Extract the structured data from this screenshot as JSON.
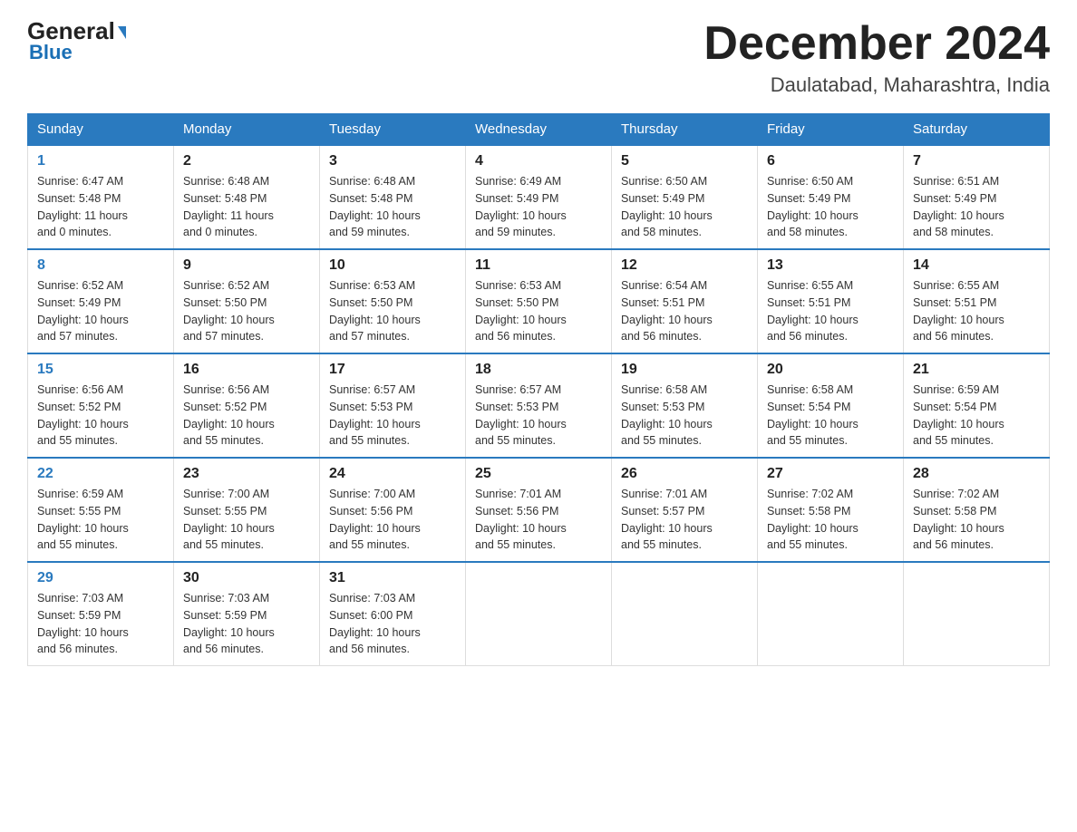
{
  "header": {
    "logo_general": "General",
    "logo_blue": "Blue",
    "month_title": "December 2024",
    "subtitle": "Daulatabad, Maharashtra, India"
  },
  "days_of_week": [
    "Sunday",
    "Monday",
    "Tuesday",
    "Wednesday",
    "Thursday",
    "Friday",
    "Saturday"
  ],
  "weeks": [
    [
      {
        "day": "1",
        "info": "Sunrise: 6:47 AM\nSunset: 5:48 PM\nDaylight: 11 hours\nand 0 minutes."
      },
      {
        "day": "2",
        "info": "Sunrise: 6:48 AM\nSunset: 5:48 PM\nDaylight: 11 hours\nand 0 minutes."
      },
      {
        "day": "3",
        "info": "Sunrise: 6:48 AM\nSunset: 5:48 PM\nDaylight: 10 hours\nand 59 minutes."
      },
      {
        "day": "4",
        "info": "Sunrise: 6:49 AM\nSunset: 5:49 PM\nDaylight: 10 hours\nand 59 minutes."
      },
      {
        "day": "5",
        "info": "Sunrise: 6:50 AM\nSunset: 5:49 PM\nDaylight: 10 hours\nand 58 minutes."
      },
      {
        "day": "6",
        "info": "Sunrise: 6:50 AM\nSunset: 5:49 PM\nDaylight: 10 hours\nand 58 minutes."
      },
      {
        "day": "7",
        "info": "Sunrise: 6:51 AM\nSunset: 5:49 PM\nDaylight: 10 hours\nand 58 minutes."
      }
    ],
    [
      {
        "day": "8",
        "info": "Sunrise: 6:52 AM\nSunset: 5:49 PM\nDaylight: 10 hours\nand 57 minutes."
      },
      {
        "day": "9",
        "info": "Sunrise: 6:52 AM\nSunset: 5:50 PM\nDaylight: 10 hours\nand 57 minutes."
      },
      {
        "day": "10",
        "info": "Sunrise: 6:53 AM\nSunset: 5:50 PM\nDaylight: 10 hours\nand 57 minutes."
      },
      {
        "day": "11",
        "info": "Sunrise: 6:53 AM\nSunset: 5:50 PM\nDaylight: 10 hours\nand 56 minutes."
      },
      {
        "day": "12",
        "info": "Sunrise: 6:54 AM\nSunset: 5:51 PM\nDaylight: 10 hours\nand 56 minutes."
      },
      {
        "day": "13",
        "info": "Sunrise: 6:55 AM\nSunset: 5:51 PM\nDaylight: 10 hours\nand 56 minutes."
      },
      {
        "day": "14",
        "info": "Sunrise: 6:55 AM\nSunset: 5:51 PM\nDaylight: 10 hours\nand 56 minutes."
      }
    ],
    [
      {
        "day": "15",
        "info": "Sunrise: 6:56 AM\nSunset: 5:52 PM\nDaylight: 10 hours\nand 55 minutes."
      },
      {
        "day": "16",
        "info": "Sunrise: 6:56 AM\nSunset: 5:52 PM\nDaylight: 10 hours\nand 55 minutes."
      },
      {
        "day": "17",
        "info": "Sunrise: 6:57 AM\nSunset: 5:53 PM\nDaylight: 10 hours\nand 55 minutes."
      },
      {
        "day": "18",
        "info": "Sunrise: 6:57 AM\nSunset: 5:53 PM\nDaylight: 10 hours\nand 55 minutes."
      },
      {
        "day": "19",
        "info": "Sunrise: 6:58 AM\nSunset: 5:53 PM\nDaylight: 10 hours\nand 55 minutes."
      },
      {
        "day": "20",
        "info": "Sunrise: 6:58 AM\nSunset: 5:54 PM\nDaylight: 10 hours\nand 55 minutes."
      },
      {
        "day": "21",
        "info": "Sunrise: 6:59 AM\nSunset: 5:54 PM\nDaylight: 10 hours\nand 55 minutes."
      }
    ],
    [
      {
        "day": "22",
        "info": "Sunrise: 6:59 AM\nSunset: 5:55 PM\nDaylight: 10 hours\nand 55 minutes."
      },
      {
        "day": "23",
        "info": "Sunrise: 7:00 AM\nSunset: 5:55 PM\nDaylight: 10 hours\nand 55 minutes."
      },
      {
        "day": "24",
        "info": "Sunrise: 7:00 AM\nSunset: 5:56 PM\nDaylight: 10 hours\nand 55 minutes."
      },
      {
        "day": "25",
        "info": "Sunrise: 7:01 AM\nSunset: 5:56 PM\nDaylight: 10 hours\nand 55 minutes."
      },
      {
        "day": "26",
        "info": "Sunrise: 7:01 AM\nSunset: 5:57 PM\nDaylight: 10 hours\nand 55 minutes."
      },
      {
        "day": "27",
        "info": "Sunrise: 7:02 AM\nSunset: 5:58 PM\nDaylight: 10 hours\nand 55 minutes."
      },
      {
        "day": "28",
        "info": "Sunrise: 7:02 AM\nSunset: 5:58 PM\nDaylight: 10 hours\nand 56 minutes."
      }
    ],
    [
      {
        "day": "29",
        "info": "Sunrise: 7:03 AM\nSunset: 5:59 PM\nDaylight: 10 hours\nand 56 minutes."
      },
      {
        "day": "30",
        "info": "Sunrise: 7:03 AM\nSunset: 5:59 PM\nDaylight: 10 hours\nand 56 minutes."
      },
      {
        "day": "31",
        "info": "Sunrise: 7:03 AM\nSunset: 6:00 PM\nDaylight: 10 hours\nand 56 minutes."
      },
      {
        "day": "",
        "info": ""
      },
      {
        "day": "",
        "info": ""
      },
      {
        "day": "",
        "info": ""
      },
      {
        "day": "",
        "info": ""
      }
    ]
  ]
}
